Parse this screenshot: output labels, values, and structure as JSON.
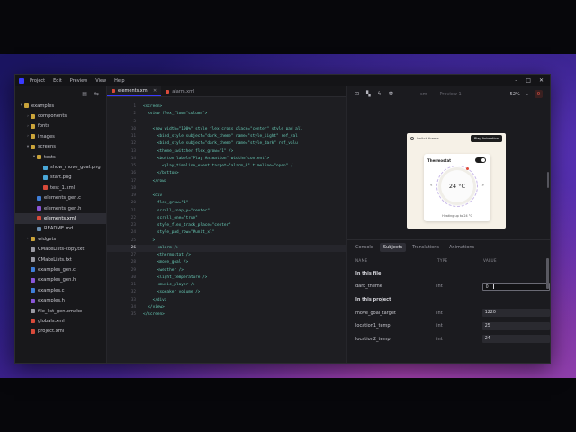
{
  "menu": [
    "Project",
    "Edit",
    "Preview",
    "View",
    "Help"
  ],
  "window_controls": [
    "–",
    "□",
    "✕"
  ],
  "sidebar": {
    "tree": [
      {
        "label": "examples",
        "depth": 0,
        "kind": "folder",
        "chevron": "▾"
      },
      {
        "label": "components",
        "depth": 1,
        "kind": "folder",
        "chevron": "›"
      },
      {
        "label": "fonts",
        "depth": 1,
        "kind": "folder",
        "chevron": "›"
      },
      {
        "label": "images",
        "depth": 1,
        "kind": "folder",
        "chevron": "›"
      },
      {
        "label": "screens",
        "depth": 1,
        "kind": "folder",
        "chevron": "▾"
      },
      {
        "label": "tests",
        "depth": 2,
        "kind": "folder",
        "chevron": "▾"
      },
      {
        "label": "show_move_goal.png",
        "depth": 3,
        "kind": "png",
        "chevron": ""
      },
      {
        "label": "start.png",
        "depth": 3,
        "kind": "png",
        "chevron": ""
      },
      {
        "label": "test_1.xml",
        "depth": 3,
        "kind": "xml",
        "chevron": ""
      },
      {
        "label": "elements_gen.c",
        "depth": 2,
        "kind": "c",
        "chevron": ""
      },
      {
        "label": "elements_gen.h",
        "depth": 2,
        "kind": "h",
        "chevron": ""
      },
      {
        "label": "elements.xml",
        "depth": 2,
        "kind": "xml",
        "chevron": "",
        "selected": true
      },
      {
        "label": "README.md",
        "depth": 2,
        "kind": "md",
        "chevron": ""
      },
      {
        "label": "widgets",
        "depth": 1,
        "kind": "folder",
        "chevron": "›"
      },
      {
        "label": "CMakeLists-copy.txt",
        "depth": 1,
        "kind": "txt",
        "chevron": ""
      },
      {
        "label": "CMakeLists.txt",
        "depth": 1,
        "kind": "txt",
        "chevron": ""
      },
      {
        "label": "examples_gen.c",
        "depth": 1,
        "kind": "c",
        "chevron": ""
      },
      {
        "label": "examples_gen.h",
        "depth": 1,
        "kind": "h",
        "chevron": ""
      },
      {
        "label": "examples.c",
        "depth": 1,
        "kind": "c",
        "chevron": ""
      },
      {
        "label": "examples.h",
        "depth": 1,
        "kind": "h",
        "chevron": ""
      },
      {
        "label": "file_list_gen.cmake",
        "depth": 1,
        "kind": "txt",
        "chevron": ""
      },
      {
        "label": "globals.xml",
        "depth": 1,
        "kind": "xml",
        "chevron": ""
      },
      {
        "label": "project.xml",
        "depth": 1,
        "kind": "xml",
        "chevron": ""
      }
    ]
  },
  "editor": {
    "tabs": [
      {
        "label": "elements.xml",
        "active": true
      },
      {
        "label": "alarm.xml",
        "active": false
      }
    ],
    "current_line": "26",
    "lines": [
      {
        "n": "1",
        "t": "<screen>"
      },
      {
        "n": "2",
        "t": "  <view flex_flow=\"column\">"
      },
      {
        "n": "3",
        "t": ""
      },
      {
        "n": "10",
        "t": "    <row width=\"100%\" style_flex_cross_place=\"center\" style_pad_all"
      },
      {
        "n": "11",
        "t": "      <bind_style subject=\"dark_theme\" name=\"style_light\" ref_val"
      },
      {
        "n": "12",
        "t": "      <bind_style subject=\"dark_theme\" name=\"style_dark\" ref_valu"
      },
      {
        "n": "13",
        "t": "      <theme_switcher flex_grow=\"1\" />"
      },
      {
        "n": "14",
        "t": "      <button label=\"Play Animation\" width=\"content\">"
      },
      {
        "n": "15",
        "t": "        <play_timeline_event target=\"alarm_0\" timeline=\"open\" /"
      },
      {
        "n": "16",
        "t": "      </button>"
      },
      {
        "n": "17",
        "t": "    </row>"
      },
      {
        "n": "18",
        "t": ""
      },
      {
        "n": "19",
        "t": "    <div"
      },
      {
        "n": "20",
        "t": "      flex_grow=\"1\""
      },
      {
        "n": "21",
        "t": "      scroll_snap_y=\"center\""
      },
      {
        "n": "22",
        "t": "      scroll_one=\"true\""
      },
      {
        "n": "23",
        "t": "      style_flex_track_place=\"center\""
      },
      {
        "n": "24",
        "t": "      style_pad_row=\"#unit_xl\""
      },
      {
        "n": "25",
        "t": "    >"
      },
      {
        "n": "26",
        "t": "      <alarm />"
      },
      {
        "n": "27",
        "t": "      <thermostat />"
      },
      {
        "n": "28",
        "t": "      <move_goal />"
      },
      {
        "n": "29",
        "t": "      <weather />"
      },
      {
        "n": "30",
        "t": "      <light_temperature />"
      },
      {
        "n": "31",
        "t": "      <music_player />"
      },
      {
        "n": "32",
        "t": "      <speaker_volume />"
      },
      {
        "n": "33",
        "t": "    </div>"
      },
      {
        "n": "34",
        "t": "  </view>"
      },
      {
        "n": "35",
        "t": "</screen>"
      }
    ]
  },
  "preview": {
    "toolbar": {
      "size": "sm",
      "preview_select": "Preview 1",
      "zoom": "52%",
      "record": "0"
    },
    "device": {
      "switch_label": "Switch theme",
      "play_button": "Play Animation",
      "card_title": "Thermostat",
      "temperature": "24 °C",
      "arrow_left": "«",
      "arrow_right": "»",
      "status_text": "Heating up to 24 °C"
    }
  },
  "panel": {
    "tabs": [
      {
        "label": "Console",
        "active": false
      },
      {
        "label": "Subjects",
        "active": true
      },
      {
        "label": "Translations",
        "active": false
      },
      {
        "label": "Animations",
        "active": false
      }
    ],
    "headers": {
      "name": "NAME",
      "type": "TYPE",
      "value": "VALUE"
    },
    "file_section": "In this file",
    "file_rows": [
      {
        "name": "dark_theme",
        "type": "int",
        "value": "0"
      }
    ],
    "project_section": "In this project",
    "project_rows": [
      {
        "name": "move_goal_target",
        "type": "int",
        "value": "1220"
      },
      {
        "name": "location1_temp",
        "type": "int",
        "value": "25"
      },
      {
        "name": "location2_temp",
        "type": "int",
        "value": "24"
      }
    ]
  },
  "colors": {
    "accent": "#3a3aff",
    "code_text": "#67c8b4",
    "record": "#ff5a4a"
  }
}
